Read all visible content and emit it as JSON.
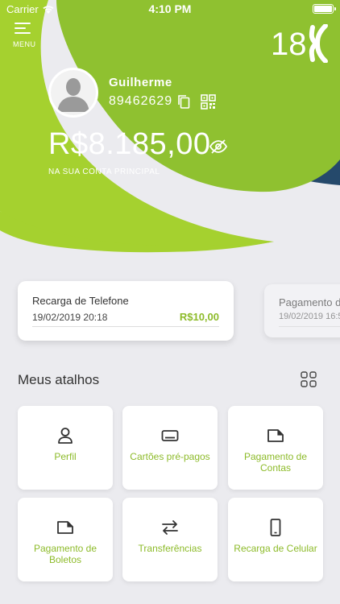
{
  "status_bar": {
    "carrier": "Carrier",
    "time": "4:10 PM"
  },
  "header": {
    "menu_label": "MENU",
    "brand_text": "18",
    "user_name": "Guilherme",
    "account_number": "89462629",
    "balance": "R$8.185,00",
    "balance_caption": "NA SUA CONTA PRINCIPAL"
  },
  "recent_transactions": [
    {
      "title": "Recarga de Telefone",
      "date": "19/02/2019 20:18",
      "amount": "R$10,00"
    },
    {
      "title": "Pagamento de",
      "date": "19/02/2019 16:5",
      "amount": ""
    }
  ],
  "shortcuts": {
    "title": "Meus atalhos",
    "items": [
      {
        "label": "Perfil",
        "icon": "person-icon"
      },
      {
        "label": "Cartões pré-pagos",
        "icon": "card-icon"
      },
      {
        "label": "Pagamento de Contas",
        "icon": "document-icon"
      },
      {
        "label": "Pagamento de Boletos",
        "icon": "document-icon"
      },
      {
        "label": "Transferências",
        "icon": "transfer-arrows-icon"
      },
      {
        "label": "Recarga de Celular",
        "icon": "phone-icon"
      }
    ]
  },
  "colors": {
    "accent_green": "#8dbb2a",
    "header_green": "#8fc130",
    "header_light_green": "#a5d12f",
    "header_navy": "#25496b",
    "background": "#ebebef"
  }
}
